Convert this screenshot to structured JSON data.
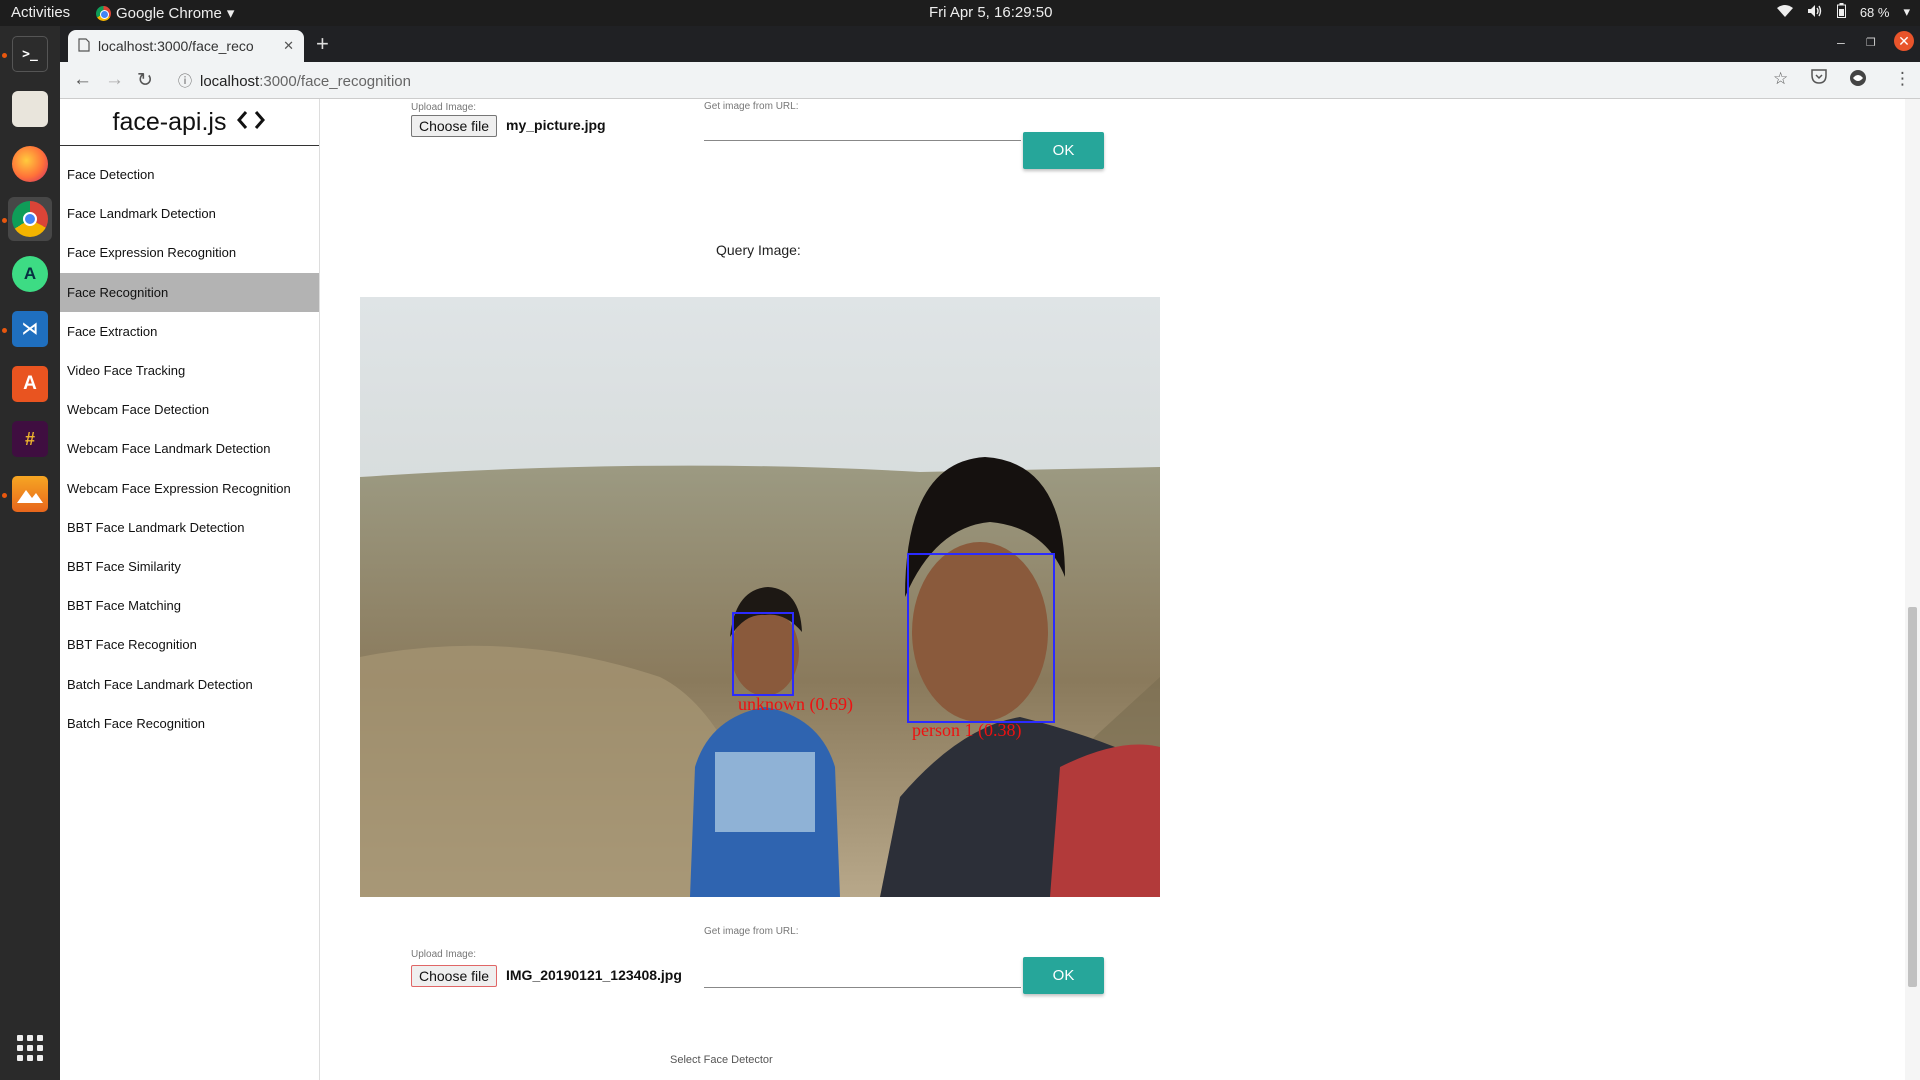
{
  "system": {
    "activities": "Activities",
    "app_name": "Google Chrome",
    "clock": "Fri Apr  5, 16:29:50",
    "battery": "68 %"
  },
  "dock": {
    "items": [
      "terminal",
      "files",
      "firefox",
      "chrome",
      "android-studio",
      "vscode",
      "software-center",
      "slack",
      "image-viewer"
    ]
  },
  "browser": {
    "tab_title": "localhost:3000/face_reco",
    "url_host": "localhost",
    "url_path": ":3000/face_recognition"
  },
  "sidebar": {
    "brand": "face-api.js",
    "brand_icon": "<>",
    "items": [
      {
        "label": "Face Detection"
      },
      {
        "label": "Face Landmark Detection"
      },
      {
        "label": "Face Expression Recognition"
      },
      {
        "label": "Face Recognition",
        "active": true
      },
      {
        "label": "Face Extraction"
      },
      {
        "label": "Video Face Tracking"
      },
      {
        "label": "Webcam Face Detection"
      },
      {
        "label": "Webcam Face Landmark Detection"
      },
      {
        "label": "Webcam Face Expression Recognition"
      },
      {
        "label": "BBT Face Landmark Detection"
      },
      {
        "label": "BBT Face Similarity"
      },
      {
        "label": "BBT Face Matching"
      },
      {
        "label": "BBT Face Recognition"
      },
      {
        "label": "Batch Face Landmark Detection"
      },
      {
        "label": "Batch Face Recognition"
      }
    ]
  },
  "reference": {
    "upload_label": "Upload Image:",
    "choose_file": "Choose file",
    "file_name": "my_picture.jpg",
    "url_label": "Get image from URL:",
    "url_value": "",
    "ok": "OK"
  },
  "query": {
    "label": "Query Image:",
    "faces": [
      {
        "label": "unknown (0.69)"
      },
      {
        "label": "person 1 (0.38)"
      }
    ],
    "upload_label": "Upload Image:",
    "choose_file": "Choose file",
    "file_name": "IMG_20190121_123408.jpg",
    "url_label": "Get image from URL:",
    "url_value": "",
    "ok": "OK"
  },
  "detector": {
    "label": "Select Face Detector"
  },
  "colors": {
    "ok_button": "#26a69a",
    "active_nav": "#b3b3b3",
    "face_box": "#2b2bff",
    "face_label": "#ee1111"
  }
}
